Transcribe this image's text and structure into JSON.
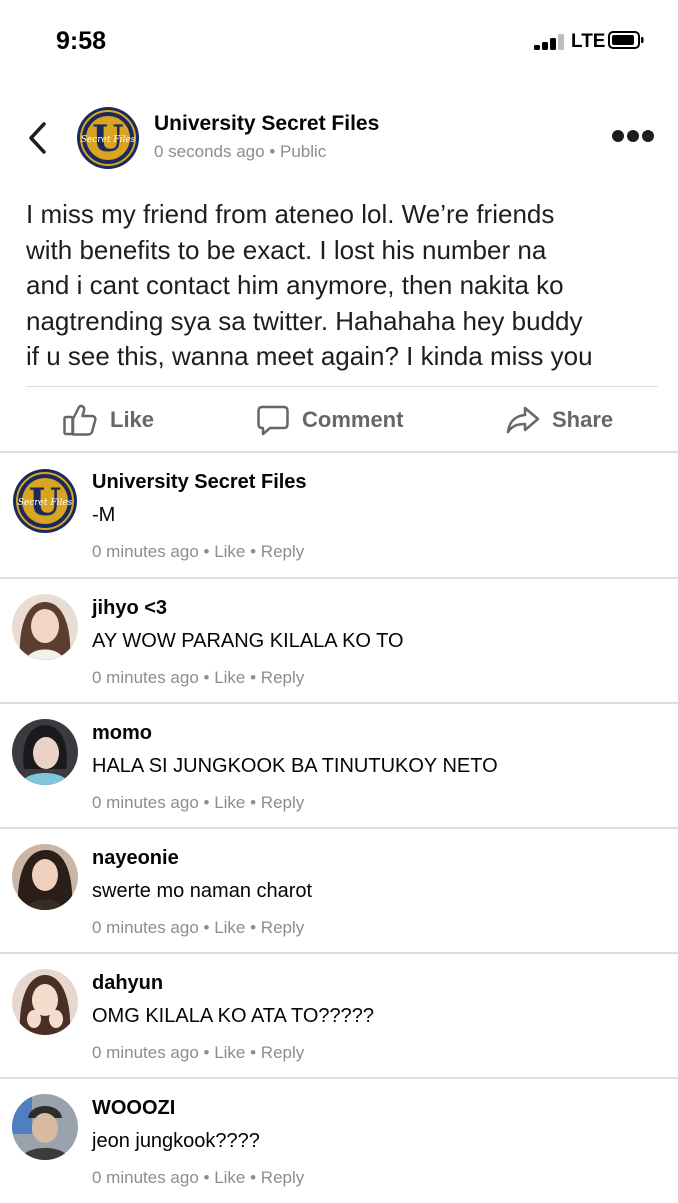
{
  "status_bar": {
    "time": "9:58",
    "network": "LTE"
  },
  "post": {
    "page_name": "University Secret Files",
    "time": "0 seconds ago",
    "separator": " • ",
    "visibility": "Public",
    "text": "I miss my friend from ateneo lol. We’re friends\nwith benefits to be exact. I lost his number na\nand i cant contact him anymore, then nakita ko\nnagtrending sya sa twitter. Hahahaha hey buddy\nif u see this, wanna meet again? I kinda miss you"
  },
  "actions": {
    "like": "Like",
    "comment": "Comment",
    "share": "Share"
  },
  "logo": {
    "letter": "U",
    "script": "Secret Files"
  },
  "comments": [
    {
      "name": "University Secret Files",
      "text": "-M",
      "time": "0 minutes ago",
      "like": "Like",
      "reply": "Reply"
    },
    {
      "name": "jihyo <3",
      "text": "AY WOW PARANG KILALA KO TO",
      "time": "0 minutes ago",
      "like": "Like",
      "reply": "Reply"
    },
    {
      "name": "momo",
      "text": "HALA SI JUNGKOOK BA TINUTUKOY NETO",
      "time": "0 minutes ago",
      "like": "Like",
      "reply": "Reply"
    },
    {
      "name": "nayeonie",
      "text": "swerte mo naman charot",
      "time": "0 minutes ago",
      "like": "Like",
      "reply": "Reply"
    },
    {
      "name": "dahyun",
      "text": "OMG KILALA KO ATA TO?????",
      "time": "0 minutes ago",
      "like": "Like",
      "reply": "Reply"
    },
    {
      "name": "WOOOZI",
      "text": "jeon jungkook????",
      "time": "0 minutes ago",
      "like": "Like",
      "reply": "Reply"
    }
  ],
  "meta_separator": " • ",
  "colors": {
    "secondary_text": "#8a8d91",
    "action_gray": "#65676b",
    "logo_navy": "#1b2a5e",
    "logo_gold": "#d9a520"
  }
}
